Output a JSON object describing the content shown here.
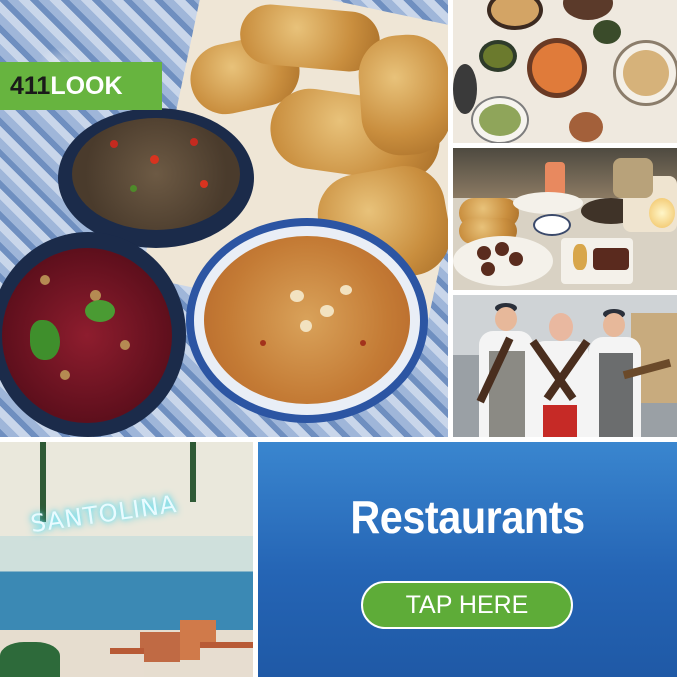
{
  "brand": {
    "number": "411",
    "word": "LOOK"
  },
  "cta": {
    "title": "Restaurants",
    "button_label": "TAP HERE"
  },
  "mural": {
    "sign_text": "SANTOLINA"
  },
  "colors": {
    "brand_green": "#67b43f",
    "cta_blue": "#2565b5",
    "button_green": "#5eac38"
  }
}
